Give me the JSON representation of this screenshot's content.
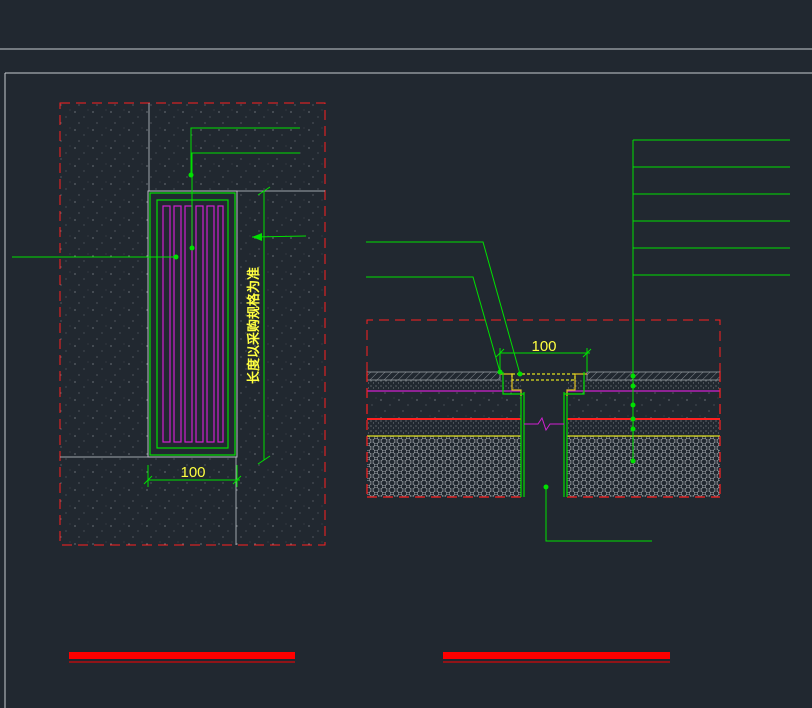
{
  "drawing": {
    "plan_view": {
      "dimension_width": "100",
      "length_note": "长度以采购规格为准"
    },
    "section_view": {
      "dimension_width": "100"
    }
  },
  "colors": {
    "background": "#212830",
    "frame": "#c8ccd0",
    "cut_line": "#ff2020",
    "leader": "#00e000",
    "grate_slots": "#d020d0",
    "dimension_text": "#ffff40",
    "title_bar": "#ff0000"
  }
}
